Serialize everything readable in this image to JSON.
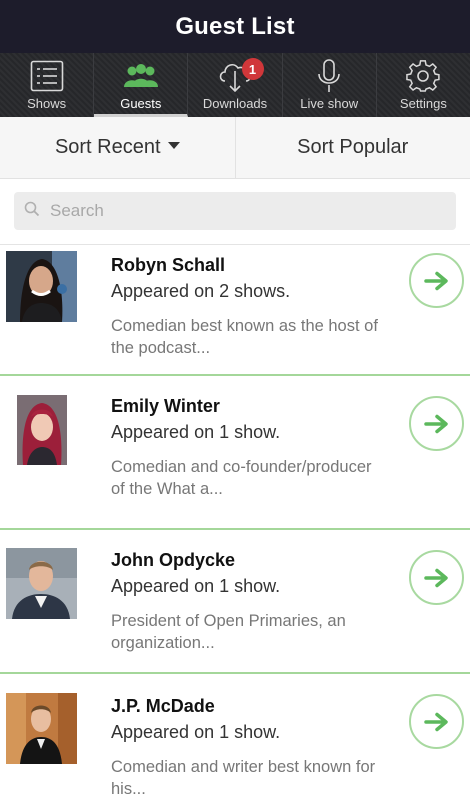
{
  "title": "Guest List",
  "tabs": [
    {
      "label": "Shows",
      "icon": "list-icon"
    },
    {
      "label": "Guests",
      "icon": "guests-icon",
      "active": true
    },
    {
      "label": "Downloads",
      "icon": "cloud-download-icon",
      "badge": "1"
    },
    {
      "label": "Live show",
      "icon": "microphone-icon"
    },
    {
      "label": "Settings",
      "icon": "gear-icon"
    }
  ],
  "sort": {
    "recent_label": "Sort Recent",
    "popular_label": "Sort Popular"
  },
  "search": {
    "placeholder": "Search",
    "value": ""
  },
  "guests": [
    {
      "name": "Robyn Schall",
      "appearances": "Appeared on 2 shows.",
      "description": "Comedian best known as the host of the podcast..."
    },
    {
      "name": "Emily Winter",
      "appearances": "Appeared on 1 show.",
      "description": "Comedian and co-founder/producer of the What a..."
    },
    {
      "name": "John Opdycke",
      "appearances": "Appeared on 1 show.",
      "description": "President of Open Primaries, an organization..."
    },
    {
      "name": "J.P. McDade",
      "appearances": "Appeared on 1 show.",
      "description": "Comedian and writer best known for his..."
    }
  ],
  "colors": {
    "title_bg": "#1d1c2b",
    "tabbar_bg": "#26272a",
    "accent_green": "#5cb85c",
    "divider_green": "#a4d79a",
    "badge_red": "#d0373a"
  }
}
